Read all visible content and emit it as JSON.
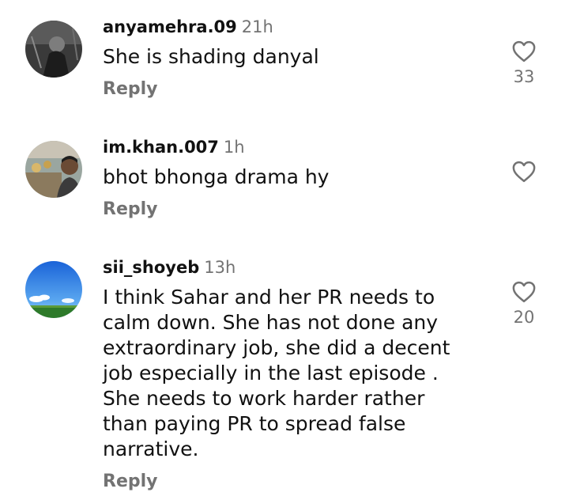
{
  "comments": [
    {
      "username": "anyamehra.09",
      "time": "21h",
      "text": "She is shading danyal",
      "reply_label": "Reply",
      "likes": "33",
      "avatar_icon": "dark-photo-avatar"
    },
    {
      "username": "im.khan.007",
      "time": "1h",
      "text": "bhot bhonga drama hy",
      "reply_label": "Reply",
      "likes": "",
      "avatar_icon": "photo-avatar-man"
    },
    {
      "username": "sii_shoyeb",
      "time": "13h",
      "text": "I think Sahar and her PR needs to calm down. She has not done any extraordinary job, she did a decent job especially in the last episode . She needs to work harder rather than paying PR to spread false narrative.",
      "reply_label": "Reply",
      "likes": "20",
      "avatar_icon": "sky-landscape-avatar"
    }
  ],
  "colors": {
    "text": "#111111",
    "muted": "#737373",
    "background": "#ffffff"
  },
  "icons": {
    "like": "heart-outline-icon"
  }
}
